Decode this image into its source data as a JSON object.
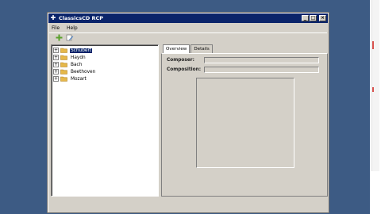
{
  "window": {
    "title": "ClassicsCD RCP",
    "buttons": [
      "_",
      "□",
      "×"
    ]
  },
  "menu": {
    "items": [
      {
        "label": "File"
      },
      {
        "label": "Help"
      }
    ]
  },
  "toolbar": {
    "icons": [
      "add-icon",
      "edit-icon"
    ]
  },
  "tree": {
    "items": [
      {
        "label": "Schubert",
        "selected": true
      },
      {
        "label": "Haydn"
      },
      {
        "label": "Bach"
      },
      {
        "label": "Beethoven"
      },
      {
        "label": "Mozart"
      }
    ]
  },
  "editor": {
    "tabs": [
      {
        "label": "Overview",
        "active": true
      },
      {
        "label": "Details"
      }
    ],
    "fields": {
      "composer_label": "Composer:",
      "composition_label": "Composition:"
    }
  },
  "colors": {
    "desktop": "#3d5b84",
    "titlebar": "#0a246a",
    "selection": "#0a246a",
    "folder": "#e6b84a"
  }
}
